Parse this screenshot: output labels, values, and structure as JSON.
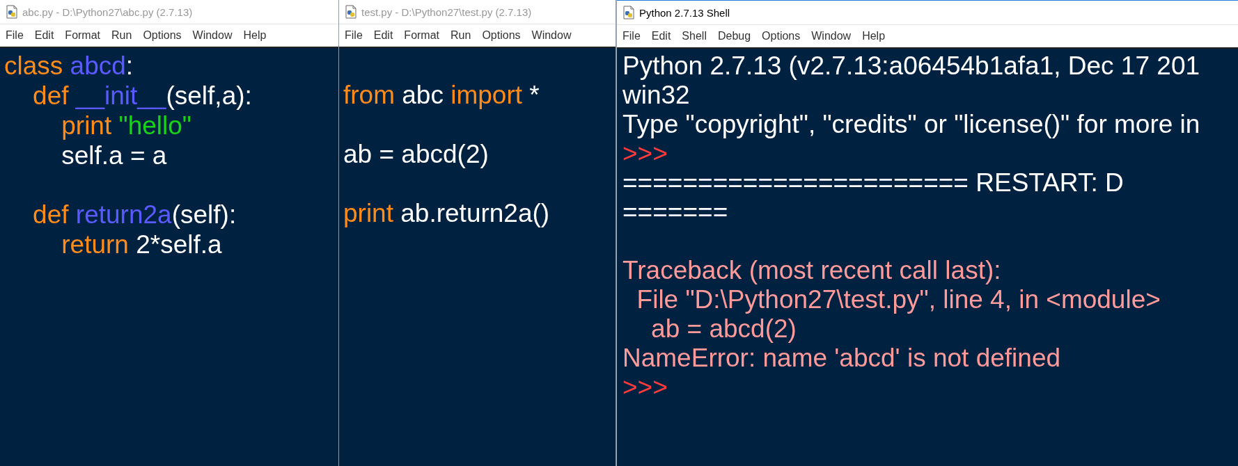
{
  "windows": [
    {
      "kind": "editor",
      "title": "abc.py - D:\\Python27\\abc.py (2.7.13)",
      "active": false,
      "menu": [
        "File",
        "Edit",
        "Format",
        "Run",
        "Options",
        "Window",
        "Help"
      ],
      "blocks": [
        [
          [
            {
              "kind": "keyword",
              "text": "class "
            },
            {
              "kind": "name",
              "text": "abcd"
            },
            {
              "kind": "plain",
              "text": ":"
            }
          ],
          [
            {
              "kind": "keyword",
              "text": "    def "
            },
            {
              "kind": "name",
              "text": "__init__"
            },
            {
              "kind": "plain",
              "text": "(self,a):"
            }
          ],
          [
            {
              "kind": "keyword",
              "text": "        print "
            },
            {
              "kind": "string",
              "text": "\"hello\""
            }
          ],
          [
            {
              "kind": "plain",
              "text": "        self.a = a"
            }
          ]
        ],
        [
          [
            {
              "kind": "keyword",
              "text": "    def "
            },
            {
              "kind": "name",
              "text": "return2a"
            },
            {
              "kind": "plain",
              "text": "(self):"
            }
          ],
          [
            {
              "kind": "keyword",
              "text": "        return "
            },
            {
              "kind": "plain",
              "text": "2*self.a"
            }
          ]
        ]
      ]
    },
    {
      "kind": "editor",
      "title": "test.py - D:\\Python27\\test.py (2.7.13)",
      "active": false,
      "menu": [
        "File",
        "Edit",
        "Format",
        "Run",
        "Options",
        "Window"
      ],
      "blocks": [
        [
          [
            {
              "kind": "keyword",
              "text": "from "
            },
            {
              "kind": "plain",
              "text": "abc "
            },
            {
              "kind": "keyword",
              "text": "import "
            },
            {
              "kind": "plain",
              "text": "*"
            }
          ]
        ],
        [
          [
            {
              "kind": "plain",
              "text": "ab = abcd(2)"
            }
          ]
        ],
        [
          [
            {
              "kind": "keyword",
              "text": "print "
            },
            {
              "kind": "plain",
              "text": "ab.return2a()"
            }
          ]
        ]
      ]
    },
    {
      "kind": "shell",
      "title": "Python 2.7.13 Shell",
      "active": true,
      "menu": [
        "File",
        "Edit",
        "Shell",
        "Debug",
        "Options",
        "Window",
        "Help"
      ],
      "blocks": [
        [
          [
            {
              "kind": "plain",
              "text": "Python 2.7.13 (v2.7.13:a06454b1afa1, Dec 17 201"
            }
          ],
          [
            {
              "kind": "plain",
              "text": "win32"
            }
          ],
          [
            {
              "kind": "plain",
              "text": "Type \"copyright\", \"credits\" or \"license()\" for more in"
            }
          ],
          [
            {
              "kind": "prompt",
              "text": ">>>"
            }
          ],
          [
            {
              "kind": "plain",
              "text": "======================= RESTART: D"
            }
          ],
          [
            {
              "kind": "plain",
              "text": "======="
            }
          ]
        ],
        [
          [
            {
              "kind": "error",
              "text": "Traceback (most recent call last):"
            }
          ],
          [
            {
              "kind": "error",
              "text": "  File \"D:\\Python27\\test.py\", line 4, in <module>"
            }
          ],
          [
            {
              "kind": "error",
              "text": "    ab = abcd(2)"
            }
          ],
          [
            {
              "kind": "error",
              "text": "NameError: name 'abcd' is not defined"
            }
          ],
          [
            {
              "kind": "prompt",
              "text": ">>>"
            }
          ]
        ]
      ]
    }
  ]
}
